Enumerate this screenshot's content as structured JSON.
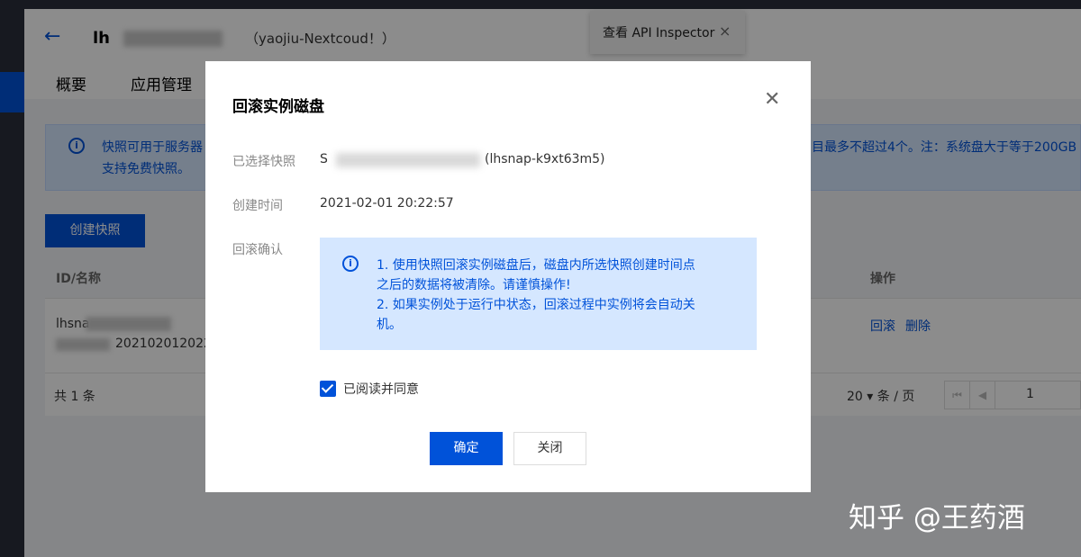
{
  "header": {
    "back_icon": "arrow-left-icon",
    "instance_name": "lh",
    "instance_alias": "（yaojiu-Nextcoud！）",
    "tabs": [
      "概要",
      "应用管理"
    ]
  },
  "inspector": {
    "label": "查看 API Inspector",
    "close": "×"
  },
  "notice": {
    "line1": "快照可用于服务器",
    "line2": "支持免费快照。",
    "line1_right": "目最多不超过4个。注：系统盘大于等于200GB"
  },
  "toolbar": {
    "create_snapshot": "创建快照"
  },
  "table": {
    "col_id": "ID/名称",
    "col_ops": "操作",
    "row_id": "lhsna",
    "row_name": "202102012022",
    "op_rollback": "回滚",
    "op_delete": "删除",
    "total": "共 1 条",
    "page_size": "20 ▾ 条 / 页",
    "page_num": "1",
    "first_page": "⏮",
    "prev_page": "◀"
  },
  "modal": {
    "title": "回滚实例磁盘",
    "close": "✕",
    "label_snapshot": "已选择快照",
    "snapshot_prefix": "S",
    "snapshot_value": "(lhsnap-k9xt63m5)",
    "label_time": "创建时间",
    "time_value": "2021-02-01 20:22:57",
    "label_confirm": "回滚确认",
    "confirm_lines": [
      "1. 使用快照回滚实例磁盘后，磁盘内所选快照创建时间点",
      "之后的数据将被清除。请谨慎操作!",
      "2. 如果实例处于运行中状态，回滚过程中实例将会自动关",
      "机。"
    ],
    "agree_label": "已阅读并同意",
    "ok": "确定",
    "cancel": "关闭"
  },
  "watermark": "知乎 @王药酒"
}
